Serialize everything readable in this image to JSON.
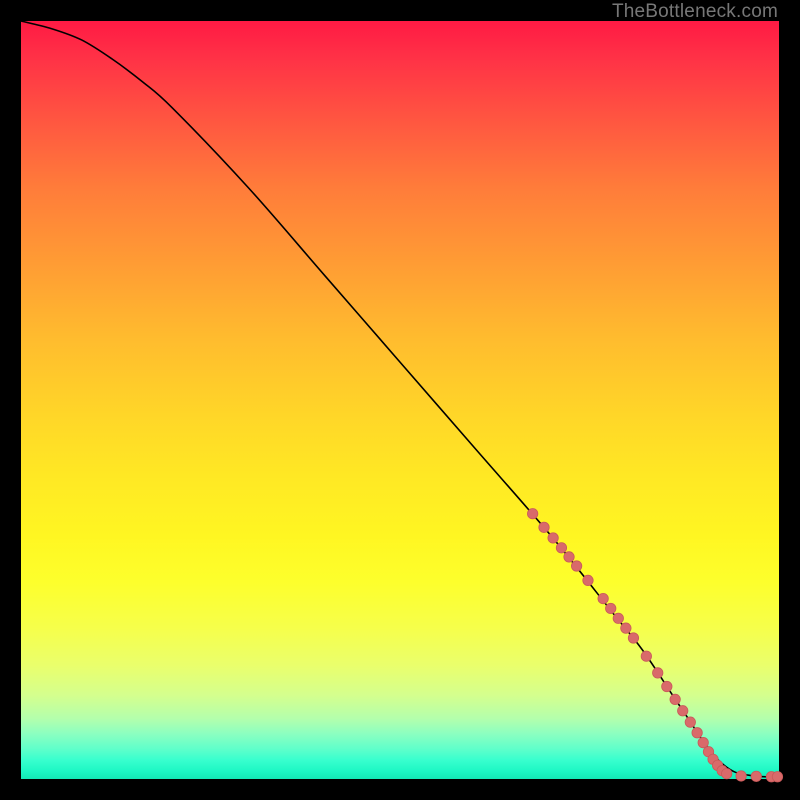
{
  "watermark": "TheBottleneck.com",
  "colors": {
    "curve": "#000000",
    "marker_fill": "#d96a6a",
    "marker_stroke": "#c95a5a"
  },
  "chart_data": {
    "type": "line",
    "title": "",
    "xlabel": "",
    "ylabel": "",
    "xlim": [
      0,
      100
    ],
    "ylim": [
      0,
      100
    ],
    "series": [
      {
        "name": "curve",
        "x": [
          0,
          4,
          8,
          12,
          16,
          20,
          30,
          40,
          50,
          60,
          70,
          78,
          82,
          86,
          88,
          90,
          92,
          94,
          96,
          98,
          100
        ],
        "y": [
          100,
          99,
          97.5,
          95,
          92,
          88.5,
          78,
          66.5,
          55,
          43.5,
          32,
          22,
          17,
          11,
          8,
          5,
          2.5,
          1,
          0.5,
          0.3,
          0.3
        ]
      }
    ],
    "markers": [
      {
        "x": 67.5,
        "y": 35.0
      },
      {
        "x": 69.0,
        "y": 33.2
      },
      {
        "x": 70.2,
        "y": 31.8
      },
      {
        "x": 71.3,
        "y": 30.5
      },
      {
        "x": 72.3,
        "y": 29.3
      },
      {
        "x": 73.3,
        "y": 28.1
      },
      {
        "x": 74.8,
        "y": 26.2
      },
      {
        "x": 76.8,
        "y": 23.8
      },
      {
        "x": 77.8,
        "y": 22.5
      },
      {
        "x": 78.8,
        "y": 21.2
      },
      {
        "x": 79.8,
        "y": 19.9
      },
      {
        "x": 80.8,
        "y": 18.6
      },
      {
        "x": 82.5,
        "y": 16.2
      },
      {
        "x": 84.0,
        "y": 14.0
      },
      {
        "x": 85.2,
        "y": 12.2
      },
      {
        "x": 86.3,
        "y": 10.5
      },
      {
        "x": 87.3,
        "y": 9.0
      },
      {
        "x": 88.3,
        "y": 7.5
      },
      {
        "x": 89.2,
        "y": 6.1
      },
      {
        "x": 90.0,
        "y": 4.8
      },
      {
        "x": 90.7,
        "y": 3.6
      },
      {
        "x": 91.3,
        "y": 2.6
      },
      {
        "x": 91.9,
        "y": 1.8
      },
      {
        "x": 92.5,
        "y": 1.1
      },
      {
        "x": 93.1,
        "y": 0.7
      },
      {
        "x": 95.0,
        "y": 0.4
      },
      {
        "x": 97.0,
        "y": 0.35
      },
      {
        "x": 99.0,
        "y": 0.3
      },
      {
        "x": 99.8,
        "y": 0.3
      }
    ]
  }
}
